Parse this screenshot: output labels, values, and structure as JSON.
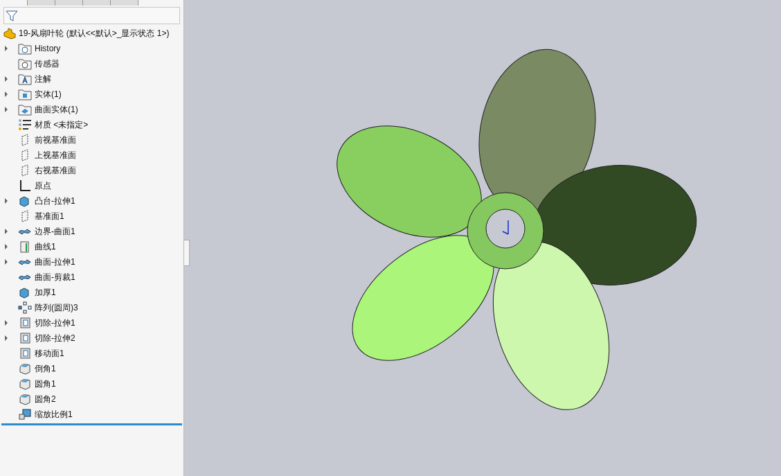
{
  "tabs": [
    {
      "selected": true
    },
    {
      "selected": false
    },
    {
      "selected": false
    },
    {
      "selected": false
    },
    {
      "selected": false
    }
  ],
  "root": {
    "label": "19-风扇叶轮  (默认<<默认>_显示状态 1>)"
  },
  "tree": [
    {
      "label": "History",
      "kind": "history",
      "expandable": true
    },
    {
      "label": "传感器",
      "kind": "sensor",
      "expandable": false
    },
    {
      "label": "注解",
      "kind": "annotation",
      "expandable": true
    },
    {
      "label": "实体(1)",
      "kind": "solid",
      "expandable": true
    },
    {
      "label": "曲面实体(1)",
      "kind": "surfacebody",
      "expandable": true
    },
    {
      "label": "材质 <未指定>",
      "kind": "material",
      "expandable": false
    },
    {
      "label": "前视基准面",
      "kind": "plane",
      "expandable": false
    },
    {
      "label": "上视基准面",
      "kind": "plane",
      "expandable": false
    },
    {
      "label": "右视基准面",
      "kind": "plane",
      "expandable": false
    },
    {
      "label": "原点",
      "kind": "origin",
      "expandable": false
    },
    {
      "label": "凸台-拉伸1",
      "kind": "extrude",
      "expandable": true
    },
    {
      "label": "基准面1",
      "kind": "plane",
      "expandable": false
    },
    {
      "label": "边界-曲面1",
      "kind": "surface",
      "expandable": true
    },
    {
      "label": "曲线1",
      "kind": "curve",
      "expandable": true
    },
    {
      "label": "曲面-拉伸1",
      "kind": "surface",
      "expandable": true
    },
    {
      "label": "曲面-剪裁1",
      "kind": "surface",
      "expandable": false
    },
    {
      "label": "加厚1",
      "kind": "extrude",
      "expandable": false
    },
    {
      "label": "阵列(圆周)3",
      "kind": "pattern",
      "expandable": false
    },
    {
      "label": "切除-拉伸1",
      "kind": "cut",
      "expandable": true
    },
    {
      "label": "切除-拉伸2",
      "kind": "cut",
      "expandable": true
    },
    {
      "label": "移动面1",
      "kind": "cut",
      "expandable": false
    },
    {
      "label": "倒角1",
      "kind": "fillet",
      "expandable": false
    },
    {
      "label": "圆角1",
      "kind": "fillet",
      "expandable": false
    },
    {
      "label": "圆角2",
      "kind": "fillet",
      "expandable": false
    },
    {
      "label": "缩放比例1",
      "kind": "scale",
      "expandable": false
    }
  ]
}
